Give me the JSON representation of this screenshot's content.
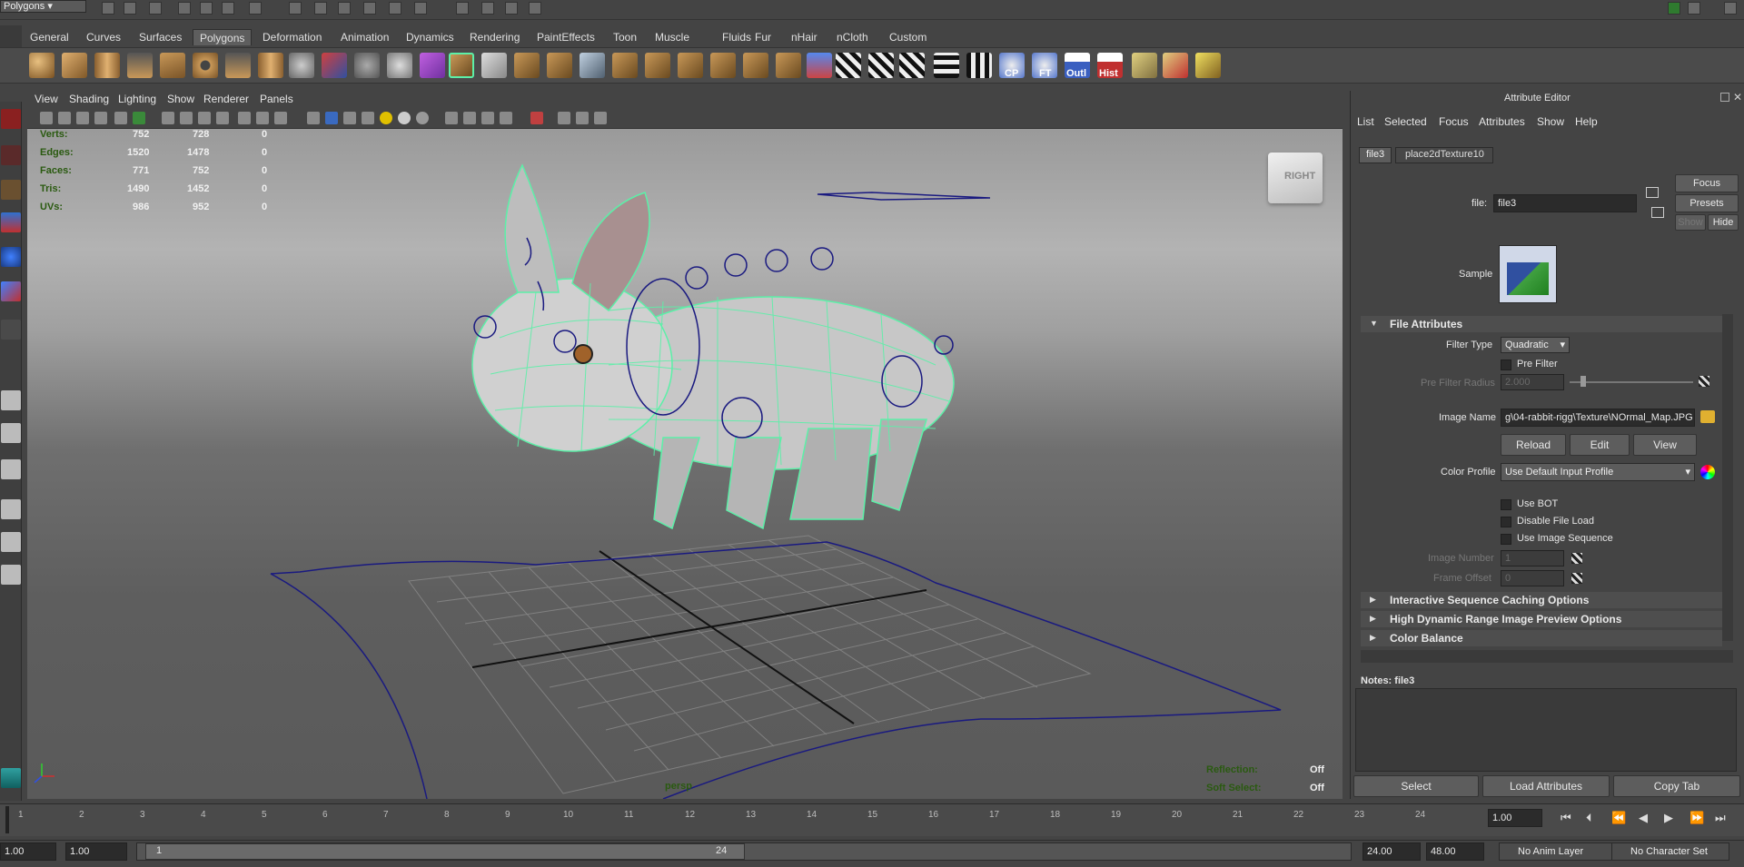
{
  "status_line": {
    "mode": "Polygons"
  },
  "shelf": {
    "tabs": [
      "General",
      "Curves",
      "Surfaces",
      "Polygons",
      "Deformation",
      "Animation",
      "Dynamics",
      "Rendering",
      "PaintEffects",
      "Toon",
      "Muscle",
      "Fluids",
      "Fur",
      "nHair",
      "nCloth",
      "Custom"
    ],
    "active_tab": "Polygons",
    "text_icons": [
      "CP",
      "FT",
      "Outl",
      "Hist"
    ]
  },
  "viewport": {
    "menu": [
      "View",
      "Shading",
      "Lighting",
      "Show",
      "Renderer",
      "Panels"
    ],
    "hud_stats": [
      {
        "label": "Verts:",
        "a": "752",
        "b": "728",
        "c": "0"
      },
      {
        "label": "Edges:",
        "a": "1520",
        "b": "1478",
        "c": "0"
      },
      {
        "label": "Faces:",
        "a": "771",
        "b": "752",
        "c": "0"
      },
      {
        "label": "Tris:",
        "a": "1490",
        "b": "1452",
        "c": "0"
      },
      {
        "label": "UVs:",
        "a": "986",
        "b": "952",
        "c": "0"
      }
    ],
    "view_cube_label": "RIGHT",
    "camera_name": "persp",
    "reflection_label": "Reflection:",
    "reflection_value": "Off",
    "soft_select_label": "Soft Select:",
    "soft_select_value": "Off"
  },
  "attribute_editor": {
    "title": "Attribute Editor",
    "menu": [
      "List",
      "Selected",
      "Focus",
      "Attributes",
      "Show",
      "Help"
    ],
    "tabs": [
      "file3",
      "place2dTexture10"
    ],
    "active_tab": "file3",
    "file_label": "file:",
    "file_value": "file3",
    "focus_button": "Focus",
    "presets_button": "Presets",
    "show_button": "Show",
    "hide_button": "Hide",
    "sample_label": "Sample",
    "section_file_attributes": "File Attributes",
    "filter_type_label": "Filter Type",
    "filter_type_value": "Quadratic",
    "pre_filter_label": "Pre Filter",
    "pre_filter_radius_label": "Pre Filter Radius",
    "pre_filter_radius_value": "2.000",
    "image_name_label": "Image Name",
    "image_name_value": "g\\04-rabbit-rigg\\Texture\\NOrmal_Map.JPG",
    "reload_button": "Reload",
    "edit_button": "Edit",
    "view_button": "View",
    "color_profile_label": "Color Profile",
    "color_profile_value": "Use Default Input Profile",
    "use_bot_label": "Use BOT",
    "disable_file_load_label": "Disable File Load",
    "use_image_sequence_label": "Use Image Sequence",
    "image_number_label": "Image Number",
    "image_number_value": "1",
    "frame_offset_label": "Frame Offset",
    "frame_offset_value": "0",
    "collapsed_sections": [
      "Interactive Sequence Caching Options",
      "High Dynamic Range Image Preview Options",
      "Color Balance"
    ],
    "notes_label": "Notes:  file3",
    "bottom_buttons": [
      "Select",
      "Load Attributes",
      "Copy Tab"
    ]
  },
  "timeline": {
    "ticks": [
      "1",
      "2",
      "3",
      "4",
      "5",
      "6",
      "7",
      "8",
      "9",
      "10",
      "11",
      "12",
      "13",
      "14",
      "15",
      "16",
      "17",
      "18",
      "19",
      "20",
      "21",
      "22",
      "23",
      "24"
    ],
    "current_frame": "1.00"
  },
  "range_bar": {
    "start_time": "1.00",
    "playback_start": "1.00",
    "range_start": "1",
    "range_end": "24",
    "playback_end": "24.00",
    "end_time": "48.00",
    "anim_layer": "No Anim Layer",
    "character_set": "No Character Set"
  },
  "colors": {
    "wireframe": "#5cf0a8",
    "curve": "#1a1a80",
    "hud_label": "#2a5a10"
  }
}
